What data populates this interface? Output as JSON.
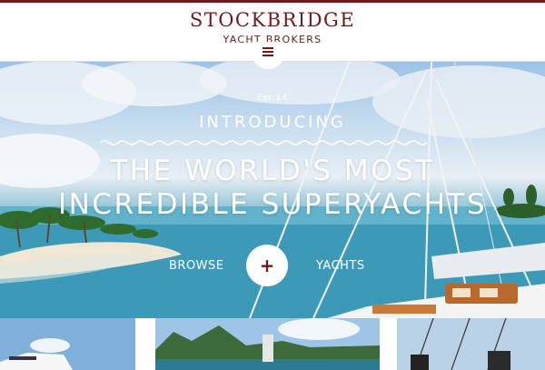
{
  "brand": {
    "name": "STOCKBRIDGE",
    "subtitle": "YACHT BROKERS",
    "color": "#6e1a1a"
  },
  "nav": {
    "menu_icon": "hamburger-menu-icon"
  },
  "hero": {
    "est": "Est.14",
    "introducing": "INTRODUCING",
    "headline_line1": "THE WORLD'S MOST",
    "headline_line2": "INCREDIBLE SUPERYACHTS",
    "browse_label": "BROWSE",
    "yachts_label": "YACHTS",
    "plus_icon": "plus-icon",
    "plus_glyph": "+"
  },
  "thumbnails": [
    {
      "name": "yacht-thumbnail-1"
    },
    {
      "name": "yacht-thumbnail-2"
    },
    {
      "name": "yacht-thumbnail-3"
    }
  ]
}
